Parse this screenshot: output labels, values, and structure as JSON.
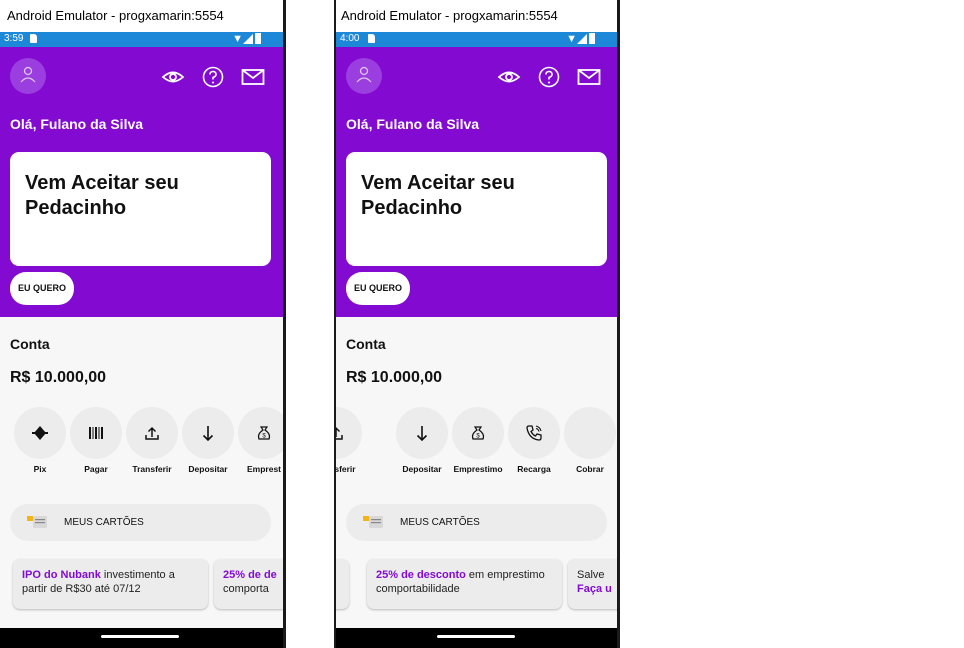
{
  "windows": [
    {
      "title": "Android Emulator - progxamarin:5554",
      "time": "3:59",
      "greeting": "Olá, Fulano da Silva",
      "promo_title": "Vem Aceitar seu Pedacinho",
      "promo_button": "EU QUERO",
      "account_label": "Conta",
      "balance": "R$ 10.000,00",
      "actions": [
        {
          "label": "Pix",
          "icon": "pix-icon"
        },
        {
          "label": "Pagar",
          "icon": "barcode-icon"
        },
        {
          "label": "Transferir",
          "icon": "upload-icon"
        },
        {
          "label": "Depositar",
          "icon": "arrow-down-icon"
        },
        {
          "label": "Emprest",
          "icon": "money-bag-icon"
        }
      ],
      "cards_label": "MEUS CARTÕES",
      "news": [
        {
          "highlight": "IPO do Nubank",
          "text": " investimento a",
          "line2": "partir de R$30 até 07/12"
        },
        {
          "highlight": "25% de de",
          "text": "",
          "line2": "comporta"
        }
      ]
    },
    {
      "title": "Android Emulator - progxamarin:5554",
      "time": "4:00",
      "greeting": "Olá, Fulano da Silva",
      "promo_title": "Vem Aceitar seu Pedacinho",
      "promo_button": "EU QUERO",
      "account_label": "Conta",
      "balance": "R$ 10.000,00",
      "actions": [
        {
          "label": "Transferir",
          "icon": "upload-icon"
        },
        {
          "label": "Depositar",
          "icon": "arrow-down-icon"
        },
        {
          "label": "Emprestimo",
          "icon": "money-bag-icon"
        },
        {
          "label": "Recarga",
          "icon": "phone-icon"
        },
        {
          "label": "Cobrar",
          "icon": "blank-icon"
        }
      ],
      "cards_label": "MEUS CARTÕES",
      "news": [
        {
          "highlight": "25% de desconto",
          "text": " em emprestimo",
          "line2": "comportabilidade"
        },
        {
          "highlight": "",
          "text": "Salve",
          "line2": "Faça u"
        }
      ]
    }
  ],
  "colors": {
    "primary": "#820ad1",
    "status_bar": "#1e88d8"
  }
}
